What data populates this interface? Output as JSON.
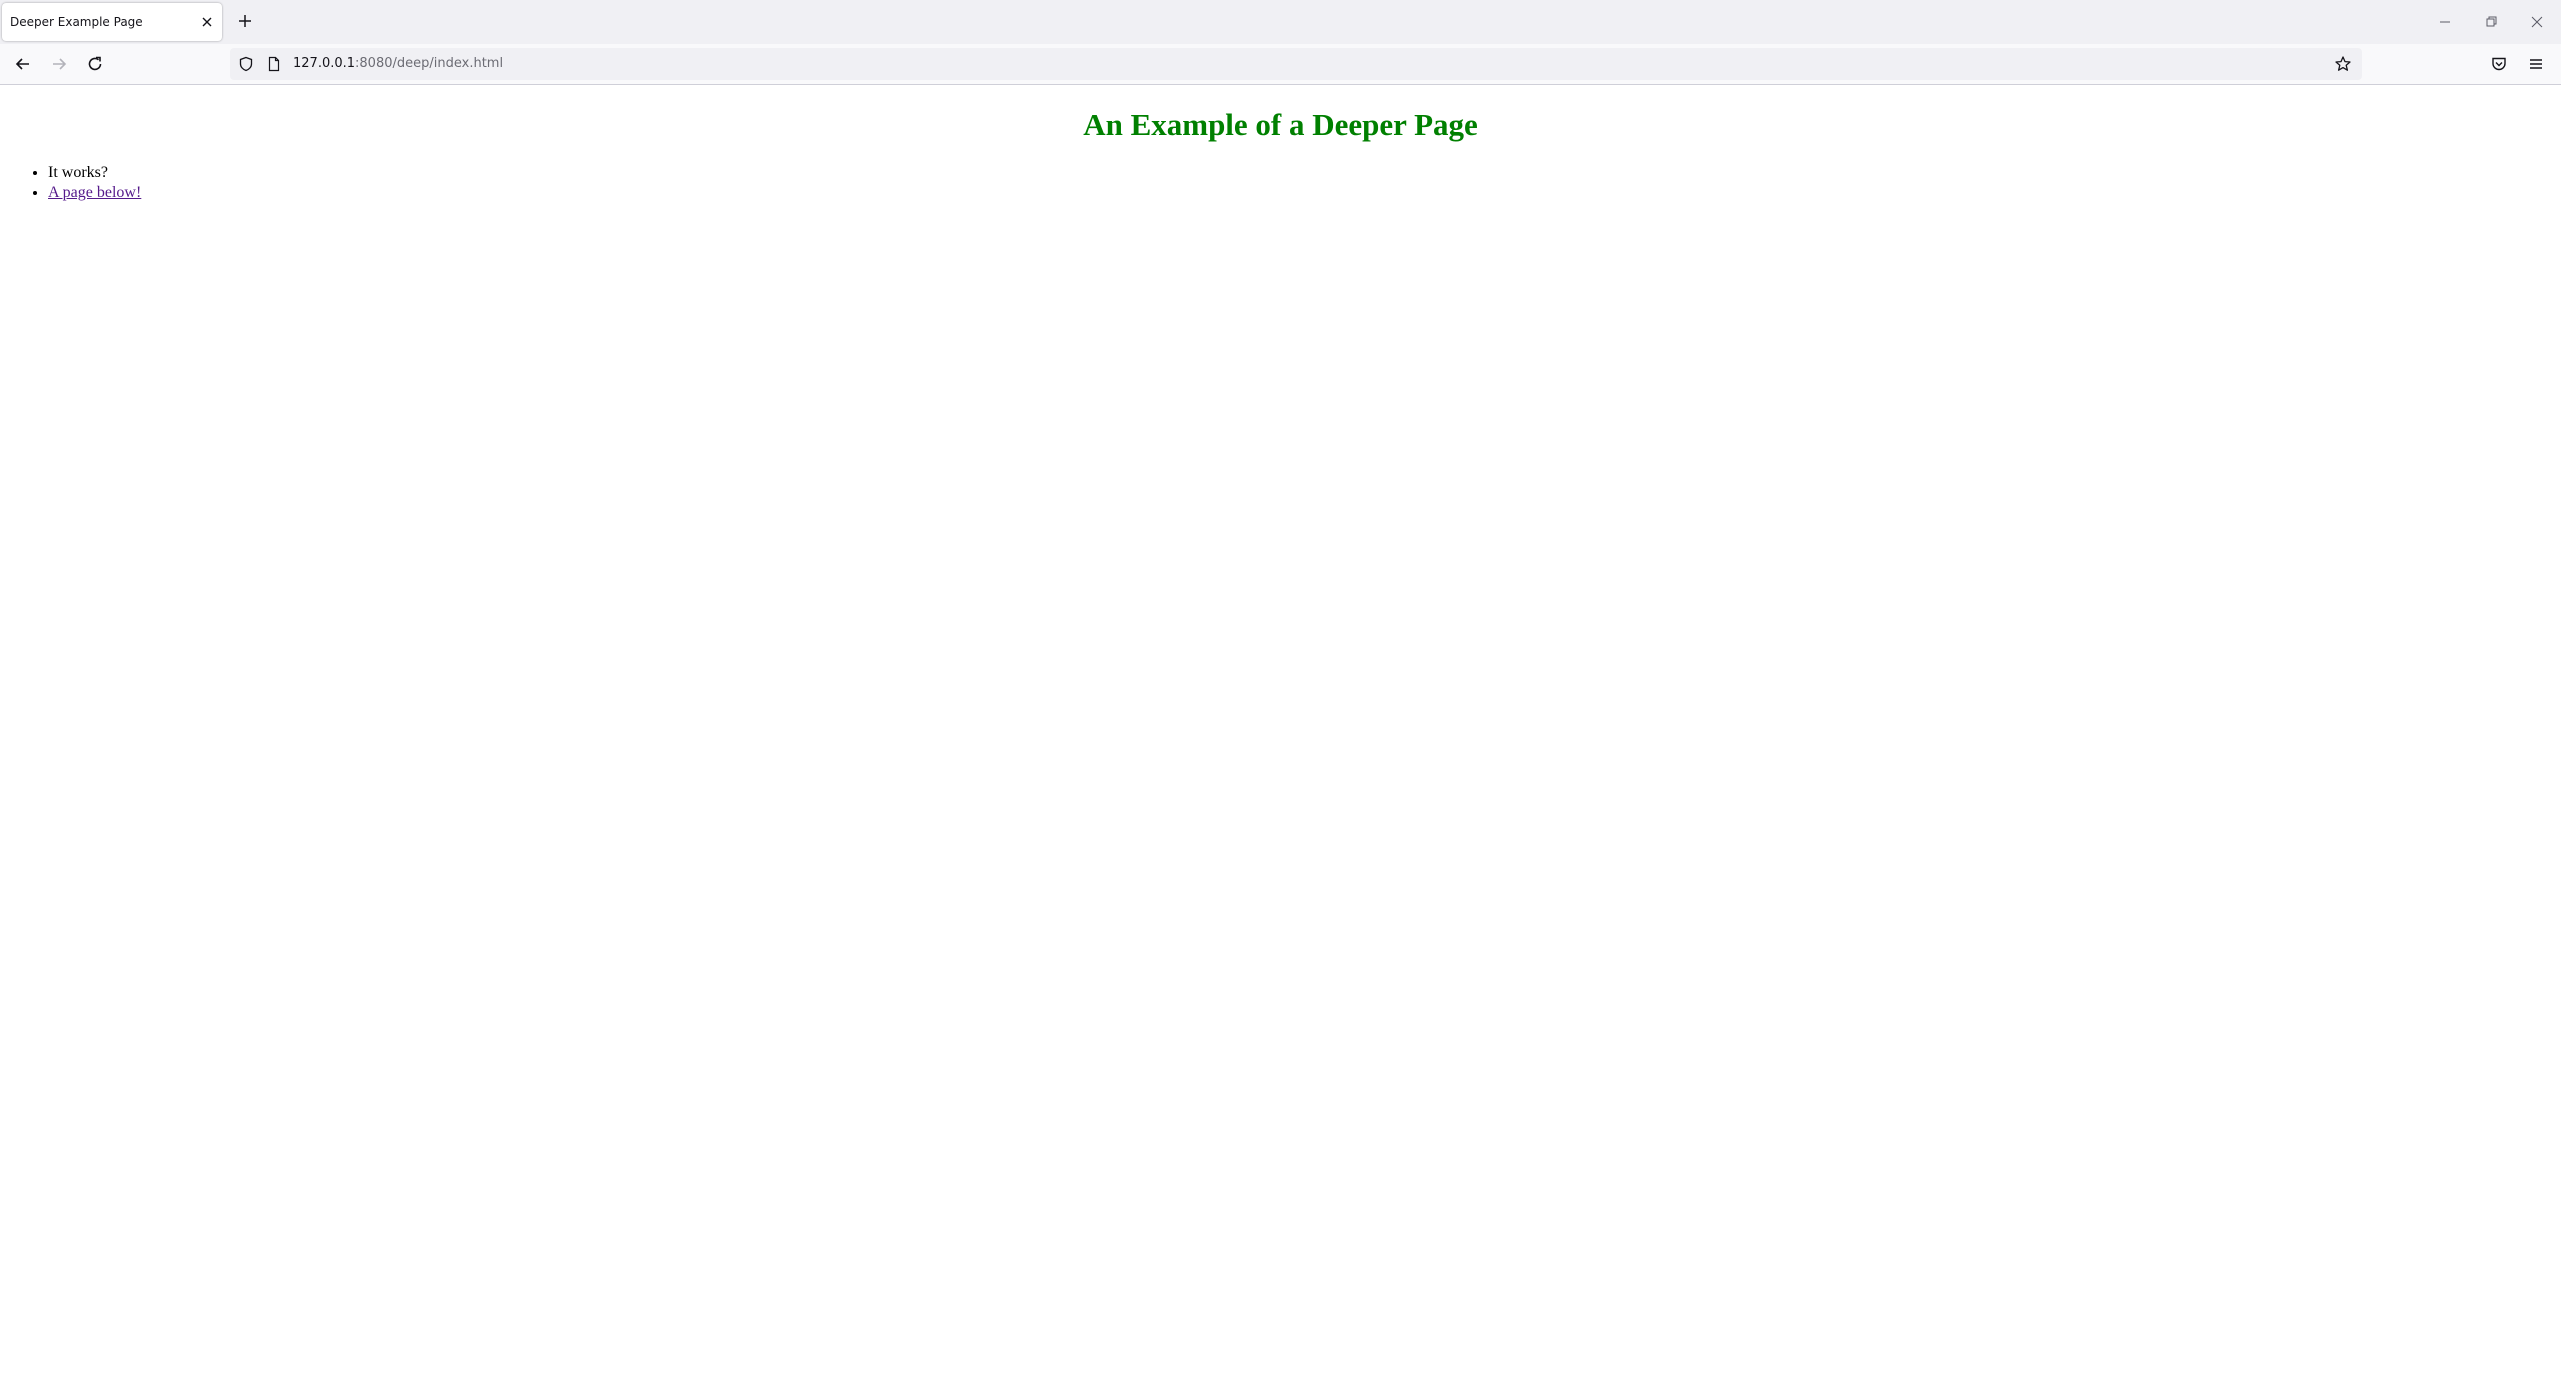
{
  "browser": {
    "tab": {
      "title": "Deeper Example Page"
    },
    "url": {
      "host": "127.0.0.1",
      "rest": ":8080/deep/index.html"
    },
    "icons": {
      "tab_close": "close-icon",
      "new_tab": "plus-icon",
      "back": "arrow-left-icon",
      "forward": "arrow-right-icon",
      "reload": "reload-icon",
      "tracking": "shield-icon",
      "page": "page-icon",
      "bookmark": "star-icon",
      "pocket": "pocket-icon",
      "menu": "hamburger-menu-icon",
      "minimize": "minimize-icon",
      "restore": "restore-icon",
      "close_window": "close-window-icon"
    }
  },
  "page": {
    "heading": "An Example of a Deeper Page",
    "heading_color": "#008000",
    "items": [
      {
        "text": "It works?"
      },
      {
        "text": "A page below!"
      }
    ],
    "link_color": "#551a8b"
  }
}
